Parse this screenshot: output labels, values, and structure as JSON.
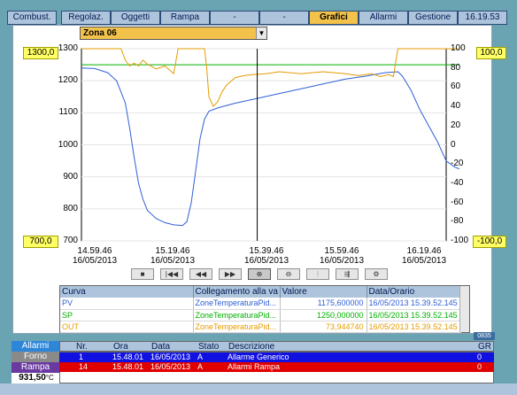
{
  "menu": {
    "tabs": [
      {
        "label": "Combust."
      },
      {
        "label": "Regolaz."
      },
      {
        "label": "Oggetti"
      },
      {
        "label": "Rampa"
      },
      {
        "label": "-"
      },
      {
        "label": "-"
      },
      {
        "label": "Grafici",
        "active": true
      },
      {
        "label": "Allarmi"
      },
      {
        "label": "Gestione"
      }
    ],
    "clock": "16.19.53"
  },
  "zone_selector": {
    "value": "Zona 06"
  },
  "scale_boxes": {
    "left_top": "1300,0",
    "left_bottom": "700,0",
    "right_top": "100,0",
    "right_bottom": "-100,0"
  },
  "chart_data": {
    "type": "line",
    "y_left": {
      "min": 700,
      "max": 1300,
      "ticks": [
        "1300",
        "1200",
        "1100",
        "1000",
        "900",
        "800",
        "700"
      ]
    },
    "y_right": {
      "min": -100,
      "max": 100,
      "ticks": [
        "100",
        "80",
        "60",
        "40",
        "20",
        "0",
        "-20",
        "-40",
        "-60",
        "-80",
        "-100"
      ]
    },
    "x_labels": [
      {
        "time": "14.59.46",
        "date": "16/05/2013"
      },
      {
        "time": "15.19.46",
        "date": "16/05/2013"
      },
      {
        "time": "15.39.46",
        "date": "16/05/2013"
      },
      {
        "time": "15.59.46",
        "date": "16/05/2013"
      },
      {
        "time": "16.19.46",
        "date": "16/05/2013"
      }
    ],
    "x_minutes_range": [
      0,
      83
    ],
    "cursor_minute": 40,
    "series": [
      {
        "name": "PV",
        "axis": "left",
        "color": "#2e5fd6",
        "points": [
          [
            0,
            1240
          ],
          [
            3,
            1238
          ],
          [
            6,
            1225
          ],
          [
            8,
            1200
          ],
          [
            10,
            1130
          ],
          [
            11,
            1050
          ],
          [
            12,
            960
          ],
          [
            13,
            880
          ],
          [
            14,
            830
          ],
          [
            15,
            795
          ],
          [
            17,
            770
          ],
          [
            19,
            757
          ],
          [
            21,
            750
          ],
          [
            23,
            748
          ],
          [
            24,
            760
          ],
          [
            25,
            820
          ],
          [
            26,
            920
          ],
          [
            27,
            1020
          ],
          [
            28,
            1080
          ],
          [
            29,
            1105
          ],
          [
            31,
            1115
          ],
          [
            35,
            1130
          ],
          [
            40,
            1145
          ],
          [
            45,
            1160
          ],
          [
            50,
            1175
          ],
          [
            55,
            1190
          ],
          [
            60,
            1205
          ],
          [
            65,
            1215
          ],
          [
            69,
            1225
          ],
          [
            72,
            1228
          ],
          [
            73,
            1215
          ],
          [
            75,
            1170
          ],
          [
            77,
            1110
          ],
          [
            79,
            1060
          ],
          [
            81,
            1010
          ],
          [
            83,
            950
          ],
          [
            85,
            930
          ],
          [
            86,
            925
          ]
        ]
      },
      {
        "name": "SP",
        "axis": "left",
        "color": "#00b000",
        "points": [
          [
            0,
            1250
          ],
          [
            86,
            1250
          ]
        ]
      },
      {
        "name": "OUT",
        "axis": "right",
        "color": "#e59b00",
        "points": [
          [
            0,
            100
          ],
          [
            9,
            100
          ],
          [
            10,
            88
          ],
          [
            11,
            82
          ],
          [
            12,
            85
          ],
          [
            13,
            82
          ],
          [
            14,
            88
          ],
          [
            15,
            84
          ],
          [
            17,
            79
          ],
          [
            19,
            82
          ],
          [
            21,
            74
          ],
          [
            22,
            100
          ],
          [
            28,
            100
          ],
          [
            28.5,
            80
          ],
          [
            29,
            50
          ],
          [
            30,
            40
          ],
          [
            31,
            45
          ],
          [
            32,
            55
          ],
          [
            33,
            62
          ],
          [
            34,
            66
          ],
          [
            35,
            70
          ],
          [
            37,
            72
          ],
          [
            39,
            73
          ],
          [
            42,
            74
          ],
          [
            45,
            76
          ],
          [
            50,
            74
          ],
          [
            55,
            76
          ],
          [
            60,
            74
          ],
          [
            63,
            72
          ],
          [
            66,
            74
          ],
          [
            68,
            71
          ],
          [
            70,
            73
          ],
          [
            71,
            71
          ],
          [
            72,
            100
          ],
          [
            86,
            100
          ]
        ]
      }
    ]
  },
  "chart_controls": {
    "buttons": [
      "stop",
      "first",
      "rewind",
      "forward",
      "zoom-in",
      "zoom-out",
      "ruler",
      "export",
      "settings"
    ]
  },
  "curve_table": {
    "headers": [
      "Curva",
      "Collegamento alla va",
      "Valore",
      "Data/Orario"
    ],
    "rows": [
      {
        "name": "PV",
        "link": "ZoneTemperaturaPid...",
        "value": "1175,600000",
        "datetime": "16/05/2013 15.39.52.145",
        "color": "#2e5fd6"
      },
      {
        "name": "SP",
        "link": "ZoneTemperaturaPid...",
        "value": "1250,000000",
        "datetime": "16/05/2013 15.39.52.145",
        "color": "#00b000"
      },
      {
        "name": "OUT",
        "link": "ZoneTemperaturaPid...",
        "value": "73,944740",
        "datetime": "16/05/2013 15.39.52.145",
        "color": "#e59b00"
      }
    ]
  },
  "badge": "0835",
  "side": {
    "allarmi": "Allarmi",
    "forno": "Forno",
    "rampa": "Rampa",
    "temperature": "931,50",
    "unit": "°C"
  },
  "alarms": {
    "headers": [
      "Nr.",
      "Ora",
      "Data",
      "Stato",
      "Descrizione",
      "GR"
    ],
    "rows": [
      {
        "nr": "1",
        "ora": "15.48.01",
        "data": "16/05/2013",
        "stato": "A",
        "descr": "Allarme Generico",
        "gr": "0",
        "color": "#1010e0"
      },
      {
        "nr": "14",
        "ora": "15.48.01",
        "data": "16/05/2013",
        "stato": "A",
        "descr": "Allarmi Rampa",
        "gr": "0",
        "color": "#e00000"
      }
    ]
  }
}
